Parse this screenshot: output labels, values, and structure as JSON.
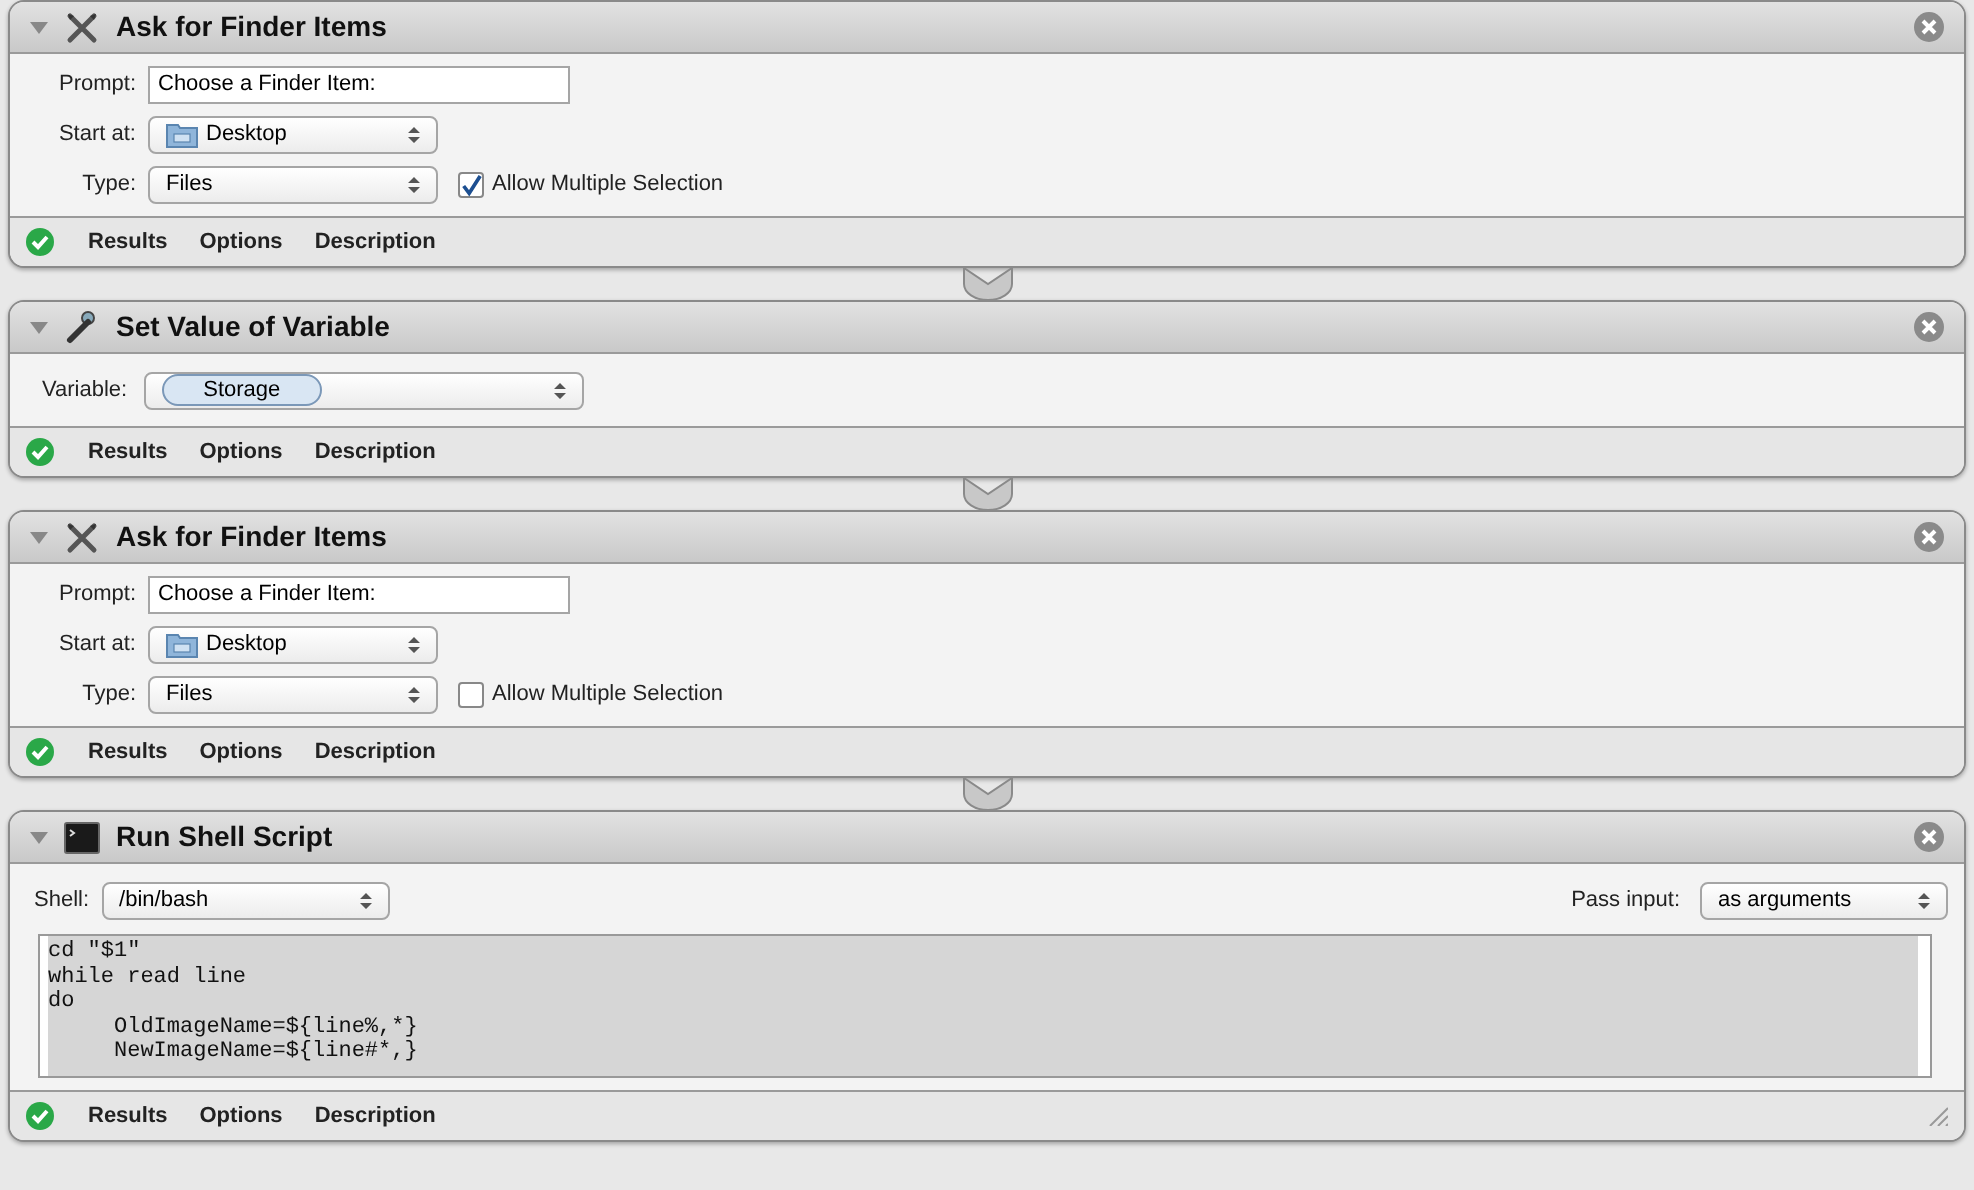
{
  "actions": [
    {
      "kind": "finder",
      "title": "Ask for Finder Items",
      "expanded": true,
      "rows": [
        {
          "kind": "text",
          "label": "Prompt:",
          "value": "Choose a Finder Item:"
        },
        {
          "kind": "folder_popup",
          "label": "Start at:",
          "value": "Desktop"
        },
        {
          "kind": "popup",
          "label": "Type:",
          "value": "Files",
          "checkbox": {
            "label": "Allow Multiple Selection",
            "checked": true
          }
        }
      ],
      "succeeded": true,
      "tabs": [
        "Results",
        "Options",
        "Description"
      ]
    },
    {
      "kind": "variable",
      "title": "Set Value of Variable",
      "expanded": true,
      "rows": [
        {
          "kind": "token_popup",
          "label": "Variable:",
          "value": "Storage"
        }
      ],
      "succeeded": true,
      "tabs": [
        "Results",
        "Options",
        "Description"
      ]
    },
    {
      "kind": "finder",
      "title": "Ask for Finder Items",
      "expanded": true,
      "rows": [
        {
          "kind": "text",
          "label": "Prompt:",
          "value": "Choose a Finder Item:"
        },
        {
          "kind": "folder_popup",
          "label": "Start at:",
          "value": "Desktop"
        },
        {
          "kind": "popup",
          "label": "Type:",
          "value": "Files",
          "checkbox": {
            "label": "Allow Multiple Selection",
            "checked": false
          }
        }
      ],
      "succeeded": true,
      "tabs": [
        "Results",
        "Options",
        "Description"
      ]
    },
    {
      "kind": "shell",
      "title": "Run Shell Script",
      "expanded": true,
      "rows": [
        {
          "kind": "popup",
          "label": "Shell:",
          "value": "/bin/bash",
          "right": {
            "label": "Pass input:",
            "value": "as arguments"
          }
        }
      ],
      "code": [
        "cd \"$1\"",
        "while read line",
        "do",
        "     OldImageName=${line%,*}",
        "     NewImageName=${line#*,}"
      ],
      "succeeded": true,
      "tabs": [
        "Results",
        "Options",
        "Description"
      ]
    }
  ]
}
